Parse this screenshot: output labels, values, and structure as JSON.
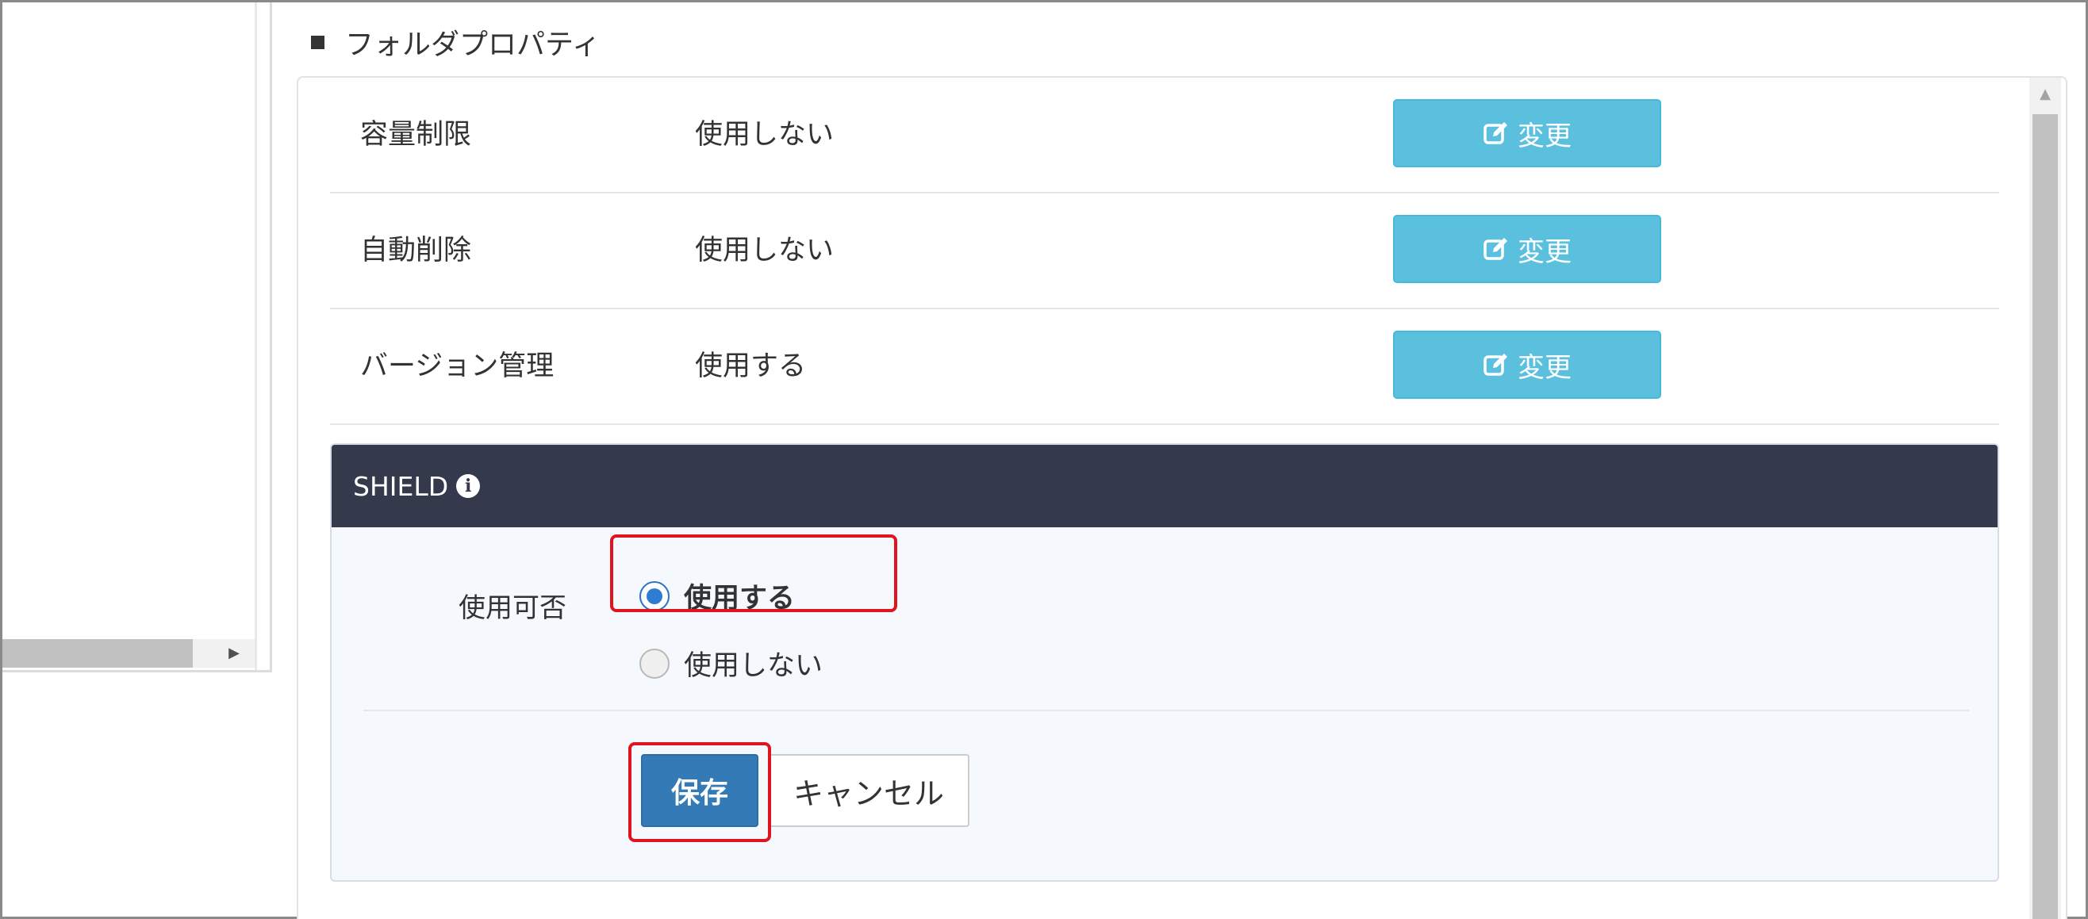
{
  "section": {
    "title": "フォルダプロパティ"
  },
  "properties": [
    {
      "label": "容量制限",
      "value": "使用しない",
      "button_label": "変更"
    },
    {
      "label": "自動削除",
      "value": "使用しない",
      "button_label": "変更"
    },
    {
      "label": "バージョン管理",
      "value": "使用する",
      "button_label": "変更"
    }
  ],
  "shield": {
    "title": "SHIELD",
    "field_label": "使用可否",
    "options": [
      {
        "label": "使用する",
        "selected": true
      },
      {
        "label": "使用しない",
        "selected": false
      }
    ],
    "save_label": "保存",
    "cancel_label": "キャンセル"
  },
  "icons": {
    "heading": "square-bullet-icon",
    "button": "edit-icon",
    "shield": "info-icon"
  },
  "colors": {
    "change_button": "#5bc0de",
    "save_button": "#337ab7",
    "shield_header": "#343a4b",
    "highlight": "#e0141e",
    "radio_selected": "#2d7dd2"
  }
}
